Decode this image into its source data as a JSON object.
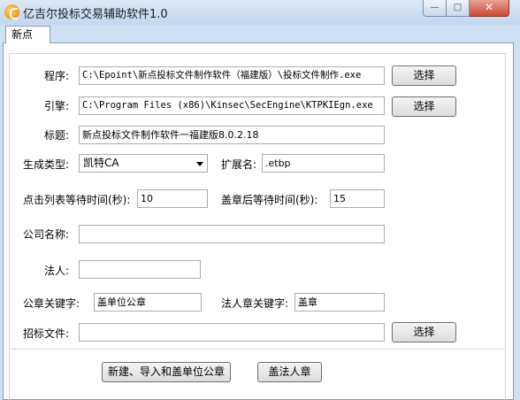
{
  "window": {
    "title": "亿吉尔投标交易辅助软件1.0",
    "min_glyph": "—",
    "max_glyph": "□",
    "close_glyph": "✕"
  },
  "tabs": [
    {
      "label": "新点"
    }
  ],
  "form": {
    "program_label": "程序:",
    "program_value": "C:\\Epoint\\新点投标文件制作软件（福建版）\\投标文件制作.exe",
    "engine_label": "引擎:",
    "engine_value": "C:\\Program Files (x86)\\Kinsec\\SecEngine\\KTPKIEgn.exe",
    "title_label": "标题:",
    "title_value": "新点投标文件制作软件一福建版8.0.2.18",
    "gen_type_label": "生成类型:",
    "gen_type_value": "凯特CA",
    "ext_label": "扩展名:",
    "ext_value": ".etbp",
    "click_wait_label": "点击列表等待时间(秒):",
    "click_wait_value": "10",
    "stamp_wait_label": "盖章后等待时间(秒):",
    "stamp_wait_value": "15",
    "company_label": "公司名称:",
    "company_value": "",
    "legal_label": "法人:",
    "legal_value": "",
    "seal_keyword_label": "公章关键字:",
    "seal_keyword_value": "盖单位公章",
    "legal_seal_keyword_label": "法人章关键字:",
    "legal_seal_keyword_value": "盖章",
    "tender_file_label": "招标文件:",
    "tender_file_value": "",
    "browse_label": "选择"
  },
  "actions": {
    "create_label": "新建、导入和盖单位公章",
    "legal_stamp_label": "盖法人章"
  },
  "colors": {
    "window_frame": "#cfe0f2",
    "close_button": "#c94a33"
  }
}
